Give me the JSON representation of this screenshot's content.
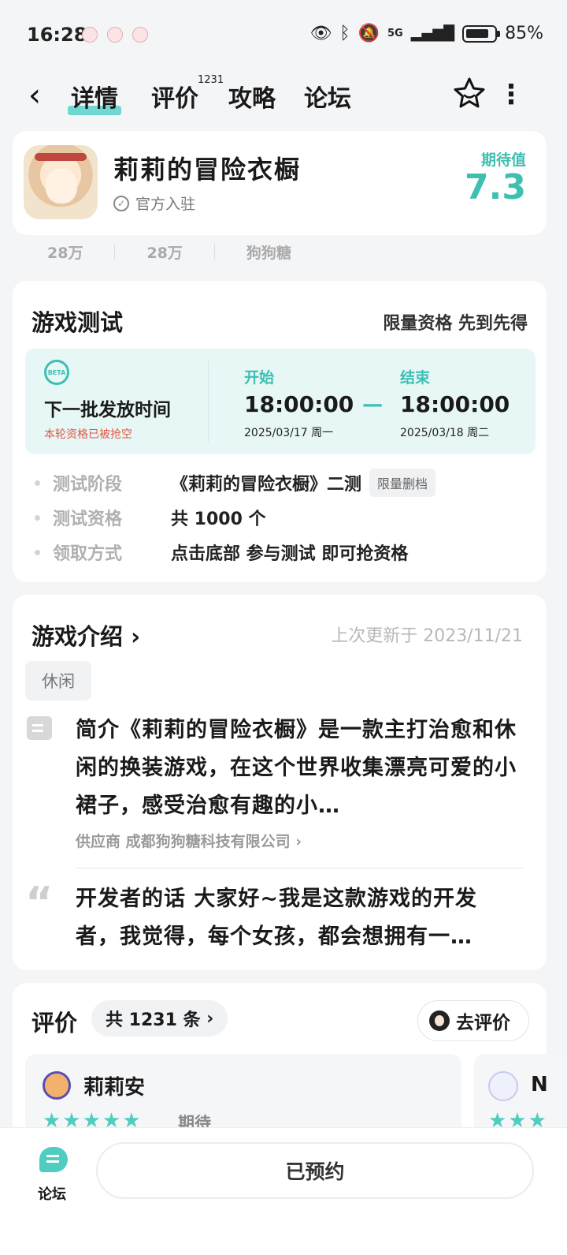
{
  "status": {
    "time": "16:28",
    "battery": "85%",
    "network": "5G"
  },
  "nav": {
    "tabs": [
      {
        "label": "详情"
      },
      {
        "label": "评价",
        "badge": "1231"
      },
      {
        "label": "攻略"
      },
      {
        "label": "论坛"
      }
    ]
  },
  "game": {
    "title": "莉莉的冒险衣橱",
    "verified": "官方入驻",
    "expect_label": "期待值",
    "expect_value": "7.3",
    "tags": [
      "28万",
      "28万",
      "狗狗糖"
    ]
  },
  "test": {
    "title": "游戏测试",
    "right": "限量资格 先到先得",
    "next_label": "下一批发放时间",
    "warn": "本轮资格已被抢空",
    "start_label": "开始",
    "start_time": "18:00:00",
    "start_date": "2025/03/17  周一",
    "end_label": "结束",
    "end_time": "18:00:00",
    "end_date": "2025/03/18  周二",
    "dash": "—",
    "rows": [
      {
        "k": "测试阶段",
        "v": "《莉莉的冒险衣橱》二测",
        "chip": "限量删档"
      },
      {
        "k": "测试资格",
        "v": "共 1000 个"
      },
      {
        "k": "领取方式",
        "v": "点击底部 参与测试 即可抢资格"
      }
    ]
  },
  "intro": {
    "title": "游戏介绍",
    "updated": "上次更新于 2023/11/21",
    "tag": "休闲",
    "desc": "简介《莉莉的冒险衣橱》是一款主打治愈和休闲的换装游戏，在这个世界收集漂亮可爱的小裙子，感受治愈有趣的小…",
    "supplier": "供应商 成都狗狗糖科技有限公司",
    "dev": "开发者的话 大家好~我是这款游戏的开发者，我觉得，每个女孩，都会想拥有一…"
  },
  "reviews": {
    "title": "评价",
    "count": "共 1231 条",
    "go": "去评价",
    "items": [
      {
        "name": "莉莉安",
        "stars": "★★★★★",
        "tag": "期待"
      },
      {
        "name": "N",
        "stars": "★★★"
      }
    ]
  },
  "bottom": {
    "forum": "论坛",
    "reserve": "已预约"
  },
  "colors": {
    "accent": "#3dbfb2",
    "warn": "#e05a47"
  }
}
